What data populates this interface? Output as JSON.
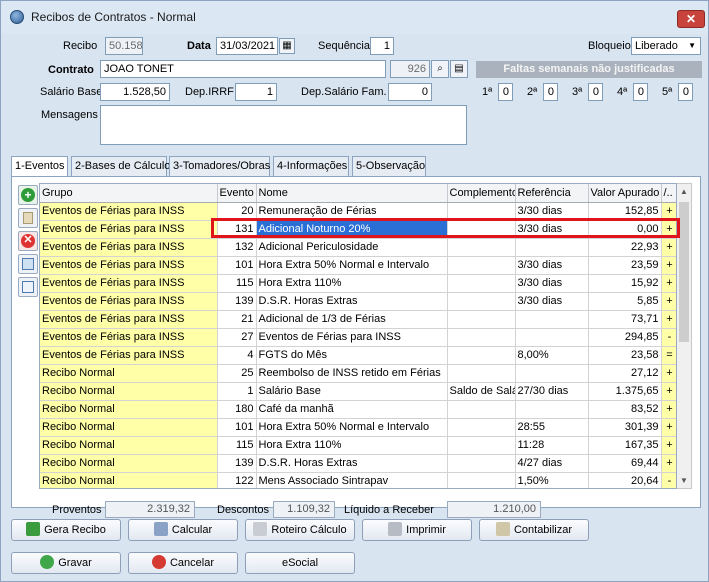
{
  "window": {
    "title": "Recibos de Contratos - Normal",
    "close": "✕"
  },
  "header": {
    "recibo_label": "Recibo",
    "recibo_value": "50.158",
    "data_label": "Data",
    "data_value": "31/03/2021",
    "sequencia_label": "Sequência",
    "sequencia_value": "1",
    "bloqueio_label": "Bloqueio",
    "bloqueio_value": "Liberado",
    "contrato_label": "Contrato",
    "contrato_value": "JOAO TONET",
    "contrato_code": "926",
    "faltas_label": "Faltas semanais não justificadas",
    "salario_label": "Salário Base",
    "salario_value": "1.528,50",
    "depirrf_label": "Dep.IRRF",
    "depirrf_value": "1",
    "depsal_label": "Dep.Salário Fam.",
    "depsal_value": "0",
    "weeks": [
      {
        "label": "1ª",
        "value": "0"
      },
      {
        "label": "2ª",
        "value": "0"
      },
      {
        "label": "3ª",
        "value": "0"
      },
      {
        "label": "4ª",
        "value": "0"
      },
      {
        "label": "5ª",
        "value": "0"
      }
    ],
    "mensagens_label": "Mensagens",
    "mensagens_value": ""
  },
  "tabs": [
    {
      "label": "1-Eventos"
    },
    {
      "label": "2-Bases de Cálculo"
    },
    {
      "label": "3-Tomadores/Obras"
    },
    {
      "label": "4-Informações"
    },
    {
      "label": "5-Observação"
    }
  ],
  "grid": {
    "columns": [
      "Grupo",
      "Evento",
      "Nome",
      "Complemento",
      "Referência",
      "Valor Apurado",
      "/.."
    ],
    "rows": [
      {
        "grupo": "Eventos de Férias para INSS",
        "evento": "20",
        "nome": "Remuneração de Férias",
        "comp": "",
        "ref": "3/30 dias",
        "valor": "152,85",
        "sinal": "+"
      },
      {
        "grupo": "Eventos de Férias para INSS",
        "evento": "131",
        "nome": "Adicional Noturno 20%",
        "comp": "",
        "ref": "3/30 dias",
        "valor": "0,00",
        "sinal": "+"
      },
      {
        "grupo": "Eventos de Férias para INSS",
        "evento": "132",
        "nome": "Adicional Periculosidade",
        "comp": "",
        "ref": "",
        "valor": "22,93",
        "sinal": "+"
      },
      {
        "grupo": "Eventos de Férias para INSS",
        "evento": "101",
        "nome": "Hora Extra 50% Normal e Intervalo",
        "comp": "",
        "ref": "3/30 dias",
        "valor": "23,59",
        "sinal": "+"
      },
      {
        "grupo": "Eventos de Férias para INSS",
        "evento": "115",
        "nome": "Hora Extra 110%",
        "comp": "",
        "ref": "3/30 dias",
        "valor": "15,92",
        "sinal": "+"
      },
      {
        "grupo": "Eventos de Férias para INSS",
        "evento": "139",
        "nome": "D.S.R. Horas Extras",
        "comp": "",
        "ref": "3/30 dias",
        "valor": "5,85",
        "sinal": "+"
      },
      {
        "grupo": "Eventos de Férias para INSS",
        "evento": "21",
        "nome": "Adicional de 1/3 de Férias",
        "comp": "",
        "ref": "",
        "valor": "73,71",
        "sinal": "+"
      },
      {
        "grupo": "Eventos de Férias para INSS",
        "evento": "27",
        "nome": "Eventos de Férias para INSS",
        "comp": "",
        "ref": "",
        "valor": "294,85",
        "sinal": "-"
      },
      {
        "grupo": "Eventos de Férias para INSS",
        "evento": "4",
        "nome": "FGTS do Mês",
        "comp": "",
        "ref": "8,00%",
        "valor": "23,58",
        "sinal": "="
      },
      {
        "grupo": "Recibo Normal",
        "evento": "25",
        "nome": "Reembolso de INSS retido em Férias",
        "comp": "",
        "ref": "",
        "valor": "27,12",
        "sinal": "+"
      },
      {
        "grupo": "Recibo Normal",
        "evento": "1",
        "nome": "Salário Base",
        "comp": "Saldo de Salá",
        "ref": "27/30 dias",
        "valor": "1.375,65",
        "sinal": "+"
      },
      {
        "grupo": "Recibo Normal",
        "evento": "180",
        "nome": "Café da manhã",
        "comp": "",
        "ref": "",
        "valor": "83,52",
        "sinal": "+"
      },
      {
        "grupo": "Recibo Normal",
        "evento": "101",
        "nome": "Hora Extra 50% Normal e Intervalo",
        "comp": "",
        "ref": "28:55",
        "valor": "301,39",
        "sinal": "+"
      },
      {
        "grupo": "Recibo Normal",
        "evento": "115",
        "nome": "Hora Extra 110%",
        "comp": "",
        "ref": "11:28",
        "valor": "167,35",
        "sinal": "+"
      },
      {
        "grupo": "Recibo Normal",
        "evento": "139",
        "nome": "D.S.R. Horas Extras",
        "comp": "",
        "ref": "4/27 dias",
        "valor": "69,44",
        "sinal": "+"
      },
      {
        "grupo": "Recibo Normal",
        "evento": "122",
        "nome": "Mens Associado Sintrapav",
        "comp": "",
        "ref": "1,50%",
        "valor": "20,64",
        "sinal": "-"
      }
    ]
  },
  "totals": {
    "proventos_label": "Proventos",
    "proventos_value": "2.319,32",
    "descontos_label": "Descontos",
    "descontos_value": "1.109,32",
    "liquido_label": "Líquido a Receber",
    "liquido_value": "1.210,00"
  },
  "buttons": {
    "gera_recibo": "Gera Recibo",
    "calcular": "Calcular",
    "roteiro": "Roteiro Cálculo",
    "imprimir": "Imprimir",
    "contabilizar": "Contabilizar",
    "gravar": "Gravar",
    "cancelar": "Cancelar",
    "esocial": "eSocial"
  }
}
